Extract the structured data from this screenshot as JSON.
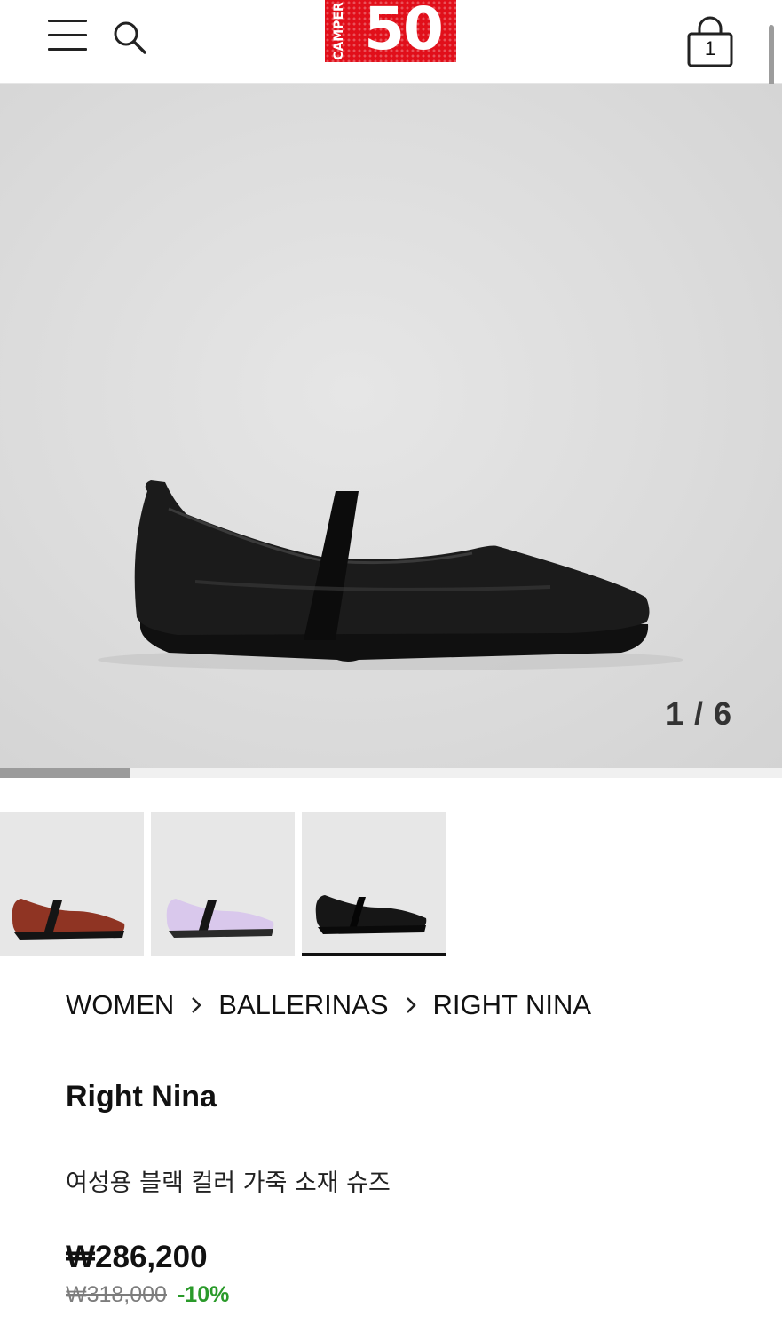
{
  "header": {
    "menu_icon": "hamburger-menu-icon",
    "search_icon": "search-icon",
    "logo": {
      "side_text": "CAMPER",
      "number": "50",
      "color": "#e10f1a"
    },
    "cart": {
      "icon": "shopping-bag-icon",
      "count": "1"
    }
  },
  "gallery": {
    "counter": "1 / 6",
    "progress_fraction": 0.1667,
    "thumbnails": [
      {
        "name": "red-brown-ballerina",
        "color": "#8f3423"
      },
      {
        "name": "lilac-ballerina",
        "color": "#d9c8ec"
      },
      {
        "name": "black-ballerina",
        "color": "#1a1a1a",
        "selected": true
      }
    ]
  },
  "breadcrumb": {
    "items": [
      "WOMEN",
      "BALLERINAS",
      "RIGHT NINA"
    ],
    "separator_icon": "chevron-right-icon"
  },
  "product": {
    "title": "Right Nina",
    "description": "여성용 블랙 컬러 가죽 소재 슈즈",
    "price": "₩286,200",
    "original_price": "₩318,000",
    "discount": "-10%",
    "discount_color": "#2a9a2a"
  }
}
